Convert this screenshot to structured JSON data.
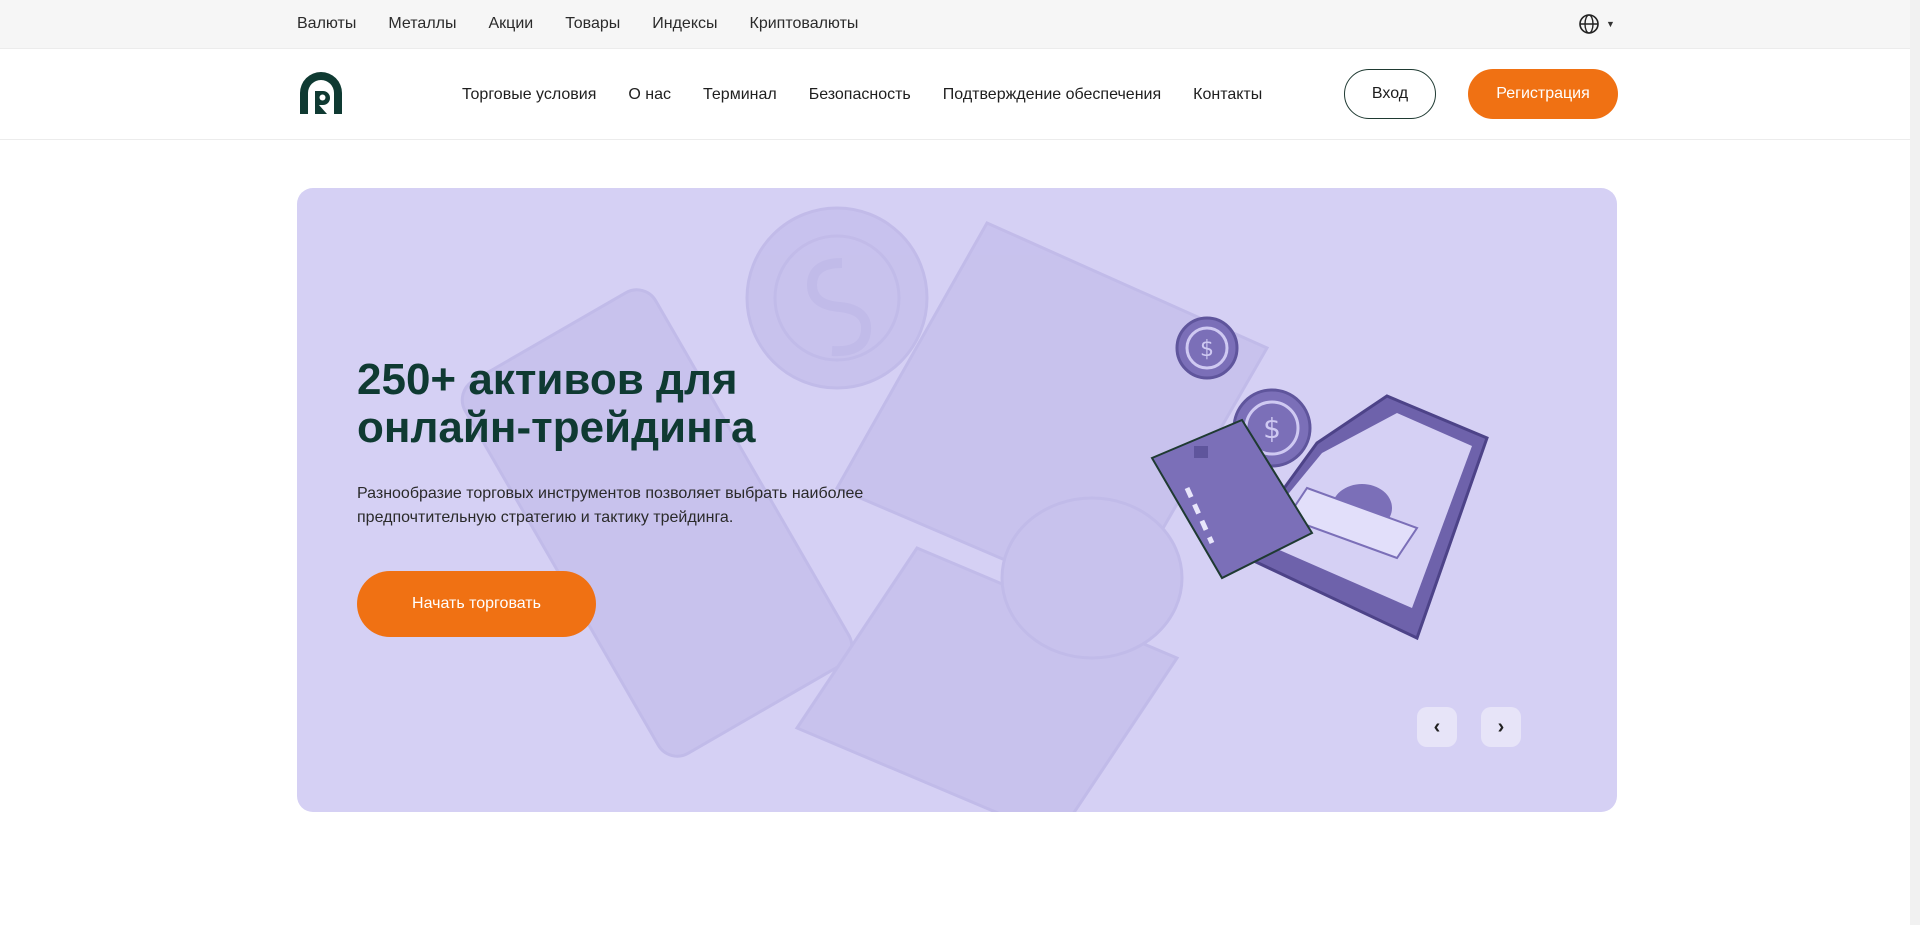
{
  "topbar": {
    "categories": [
      "Валюты",
      "Металлы",
      "Акции",
      "Товары",
      "Индексы",
      "Криптовалюты"
    ],
    "language_icon": "globe-icon"
  },
  "header": {
    "nav": [
      "Торговые условия",
      "О нас",
      "Терминал",
      "Безопасность",
      "Подтверждение обеспечения",
      "Контакты"
    ],
    "login_label": "Вход",
    "register_label": "Регистрация"
  },
  "hero": {
    "title": "250+ активов для онлайн-трейдинга",
    "description": "Разнообразие торговых инструментов позволяет выбрать наиболее предпочтительную стратегию и тактику трейдинга.",
    "cta_label": "Начать торговать",
    "prev_label": "‹",
    "next_label": "›"
  },
  "colors": {
    "accent": "#f07113",
    "brand_dark": "#0f3a32",
    "hero_bg": "#d5d0f4",
    "illustration": "#7b6fb8"
  }
}
